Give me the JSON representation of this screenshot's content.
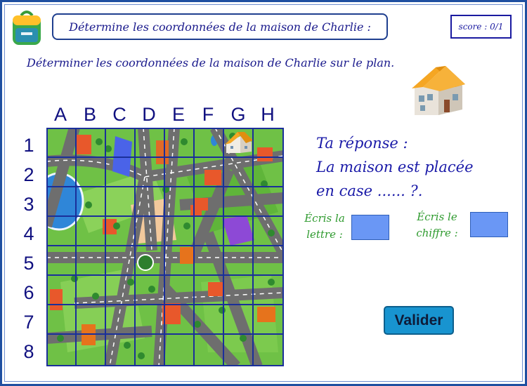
{
  "header": {
    "title": "Détermine les coordonnées de la maison de Charlie :",
    "score": "score : 0/1",
    "icon": "backpack-icon"
  },
  "instruction": "Déterminer les coordonnées de la maison de Charlie sur le plan.",
  "grid": {
    "columns": [
      "A",
      "B",
      "C",
      "D",
      "E",
      "F",
      "G",
      "H"
    ],
    "rows": [
      "1",
      "2",
      "3",
      "4",
      "5",
      "6",
      "7",
      "8"
    ],
    "house_cell": "G1"
  },
  "answer": {
    "line1": "Ta réponse :",
    "line2": "La maison est placée",
    "line3": "en case ...... ?."
  },
  "letter_input": {
    "label_line1": "Écris la",
    "label_line2": "lettre :",
    "value": ""
  },
  "digit_input": {
    "label_line1": "Écris le",
    "label_line2": "chiffre :",
    "value": ""
  },
  "validate_label": "Valider",
  "colors": {
    "frame": "#1f4fa0",
    "title_text": "#1a1a8c",
    "answer_text": "#1a1aa8",
    "label_green": "#2e9a2e",
    "input_fill": "#6a97f5",
    "button": "#1894d0"
  }
}
